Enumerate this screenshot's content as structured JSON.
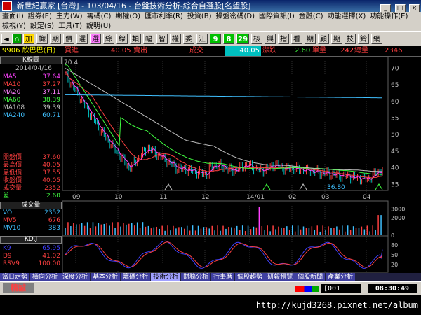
{
  "window": {
    "title": "新世紀贏家 [台灣] - 103/04/16 - 台盤技術分析-綜合自選股[名望股]"
  },
  "menu": {
    "row1": [
      "畫面(I)",
      "證券(E)",
      "主力(W)",
      "籌碼(C)",
      "期權(O)",
      "匯市利率(R)",
      "投資(B)",
      "操盤密碼(D)",
      "國際資訊(I)",
      "金融(C)",
      "功能選擇(X)",
      "功能操作(E)"
    ],
    "row2": [
      "檢視(Y)",
      "設定(S)",
      "工具(T)",
      "說明(U)"
    ]
  },
  "toolbar": {
    "buttons": [
      "加",
      "幟",
      "期",
      "價",
      "選",
      "選",
      "綜",
      "線",
      "類",
      "幅",
      "智",
      "權",
      "委",
      "江",
      "9",
      "8",
      "29",
      "核",
      "興",
      "指",
      "看",
      "期",
      "顧",
      "期",
      "技",
      "鈴",
      "網"
    ]
  },
  "infobar": {
    "stock": "9906 欣巴巴(日)",
    "buy_label": "買進",
    "buy_value": "40.05",
    "sell_label": "賣出",
    "trade_label": "成交",
    "trade_value": "40.05",
    "change_label": "漲跌",
    "change_value": "2.60",
    "vol_label": "單量",
    "vol_value": "242",
    "total_label": "總量",
    "total_value": "2346"
  },
  "kpanel": {
    "header": "K線圖",
    "date": "2014/04/16",
    "ma": [
      {
        "label": "MA5",
        "value": "37.64",
        "color": "#ff40ff"
      },
      {
        "label": "MA10",
        "value": "37.27",
        "color": "#ff4040"
      },
      {
        "label": "MA20",
        "value": "37.11",
        "color": "#ff80ff"
      },
      {
        "label": "MA60",
        "value": "38.39",
        "color": "#40ff40"
      },
      {
        "label": "MA108",
        "value": "39.39",
        "color": "#c0c0c0"
      },
      {
        "label": "MA240",
        "value": "60.71",
        "color": "#40c0ff"
      }
    ],
    "quote": [
      {
        "label": "開盤價",
        "value": "37.60"
      },
      {
        "label": "最高價",
        "value": "40.05"
      },
      {
        "label": "最低價",
        "value": "37.55"
      },
      {
        "label": "收盤價",
        "value": "40.05"
      },
      {
        "label": "成交量",
        "value": "2352"
      },
      {
        "label": "差",
        "value": "2.60"
      }
    ]
  },
  "volpanel": {
    "header": "成交量",
    "rows": [
      {
        "label": "VOL",
        "value": "2352",
        "color": "#40c0ff"
      },
      {
        "label": "MV5",
        "value": "676",
        "color": "#ff4040"
      },
      {
        "label": "MV10",
        "value": "383",
        "color": "#40c0ff"
      }
    ]
  },
  "kdpanel": {
    "header": "KD,J",
    "rows": [
      {
        "label": "K9",
        "value": "65.95",
        "color": "#4040ff"
      },
      {
        "label": "D9",
        "value": "41.02",
        "color": "#ff4040"
      },
      {
        "label": "RSV9",
        "value": "100.00",
        "color": "#ff4040"
      }
    ]
  },
  "chart": {
    "peak_label": "70.4",
    "low_label": "36.80",
    "price_ticks": [
      "70",
      "65",
      "60",
      "55",
      "50",
      "45",
      "40",
      "35"
    ],
    "vol_ticks": [
      "3000",
      "2000",
      "0"
    ],
    "kd_ticks": [
      "80",
      "50",
      "20"
    ],
    "x_labels": [
      "09",
      "10",
      "11",
      "12",
      "14/01",
      "02",
      "03",
      "04"
    ]
  },
  "bottomtabs": [
    "當日走勢",
    "橫向分析",
    "深度分析",
    "基本分析",
    "籌碼分析",
    "技術分析",
    "財務分析",
    "行事曆",
    "個股趨勢",
    "研報預覽",
    "個股新聞",
    "產業分析"
  ],
  "bottomtabs_active": 5,
  "status": {
    "left": "精誠",
    "code": "[001",
    "time": "08:30:49"
  },
  "watermark": "http://kujd3268.pixnet.net/album",
  "colors": {
    "ma_5": "#ff40ff",
    "ma_60": "#40ff40",
    "ma_108": "#c0c0c0",
    "ma_240": "#40c0ff"
  }
}
